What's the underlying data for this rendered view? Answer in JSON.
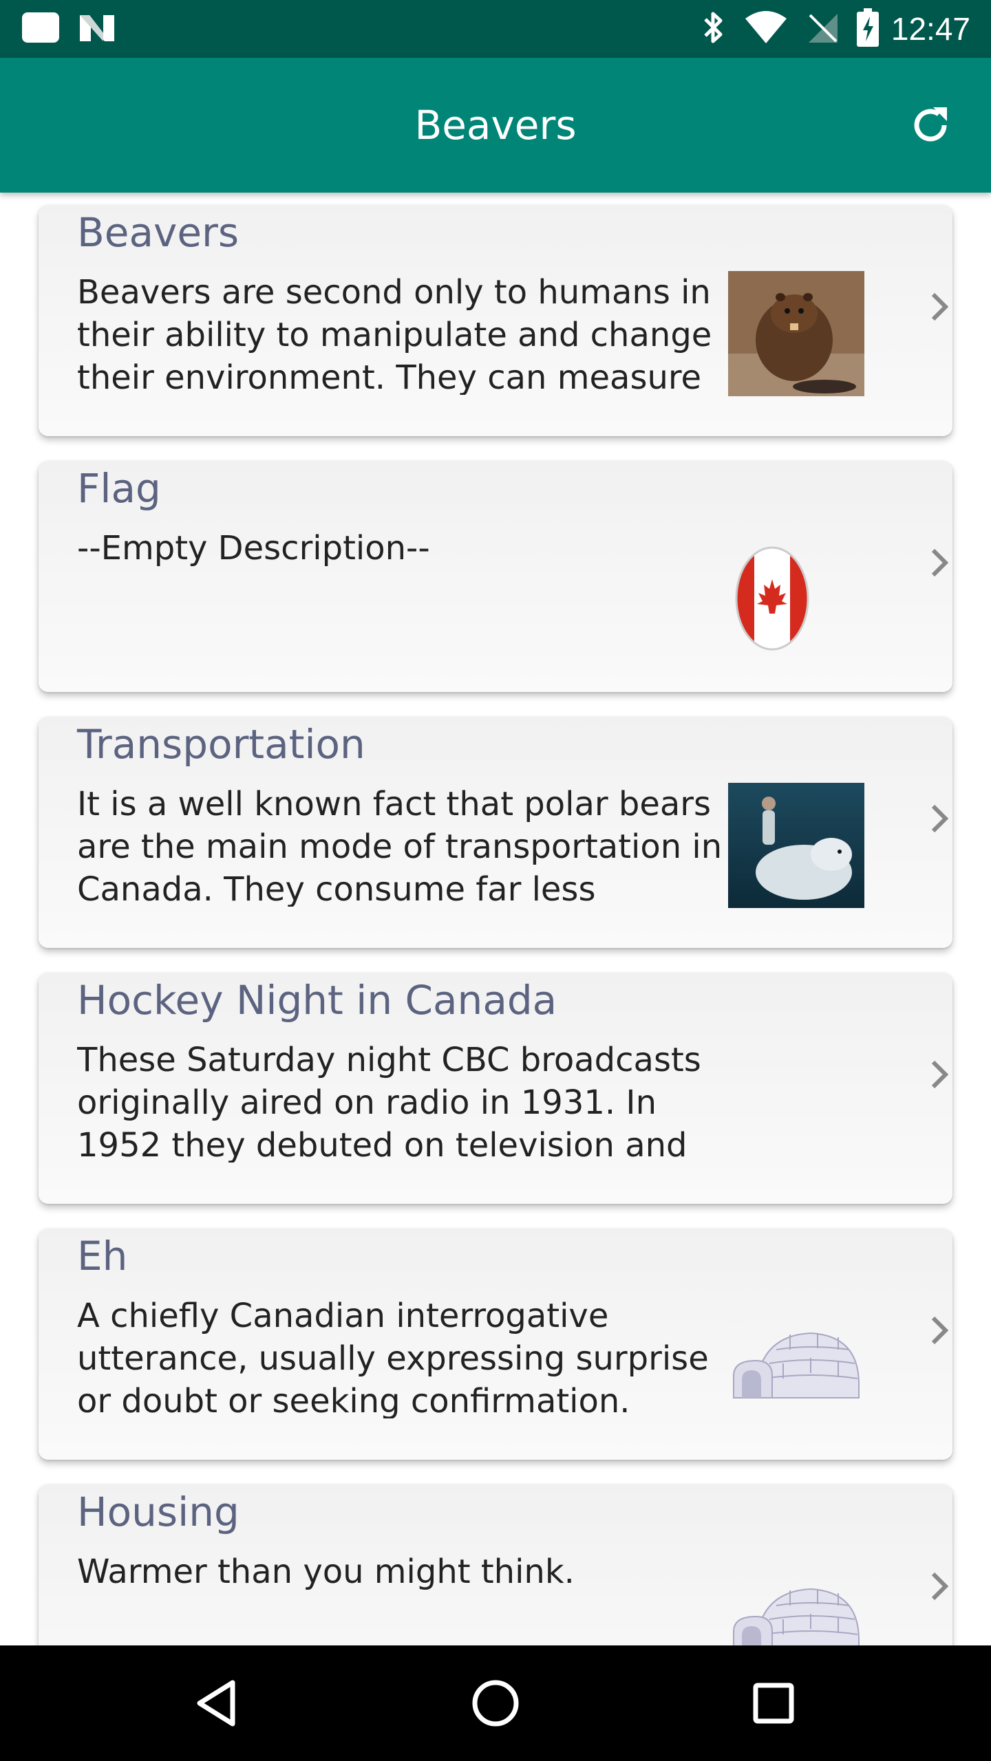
{
  "status_bar": {
    "time": "12:47",
    "icons": [
      "notification-square-icon",
      "n-logo-icon",
      "bluetooth-icon",
      "wifi-icon",
      "no-signal-icon",
      "battery-charging-icon"
    ]
  },
  "app_bar": {
    "title": "Beavers",
    "refresh_icon": "refresh-icon"
  },
  "cards": [
    {
      "title": "Beavers",
      "description": "Beavers are second only to humans in their ability to manipulate and change their environment. They can measure",
      "image": "beaver-image"
    },
    {
      "title": "Flag",
      "description": "--Empty Description--",
      "image": "canada-flag-image"
    },
    {
      "title": "Transportation",
      "description": "It is a well known fact that polar bears are the main mode of transportation in Canada. They consume far less",
      "image": "polar-bear-image"
    },
    {
      "title": "Hockey Night in Canada",
      "description": "These Saturday night CBC broadcasts originally aired on radio in 1931. In 1952 they debuted on television and",
      "image": ""
    },
    {
      "title": "Eh",
      "description": "A chiefly Canadian interrogative utterance, usually expressing surprise or doubt or seeking confirmation.",
      "image": "igloo-image"
    },
    {
      "title": "Housing",
      "description": "Warmer than you might think.",
      "image": "igloo-image"
    }
  ],
  "nav_bar": {
    "buttons": [
      "back-icon",
      "home-icon",
      "recents-icon"
    ]
  },
  "colors": {
    "status_bar": "#00574b",
    "app_bar": "#008577",
    "card_title": "#5c6380"
  }
}
